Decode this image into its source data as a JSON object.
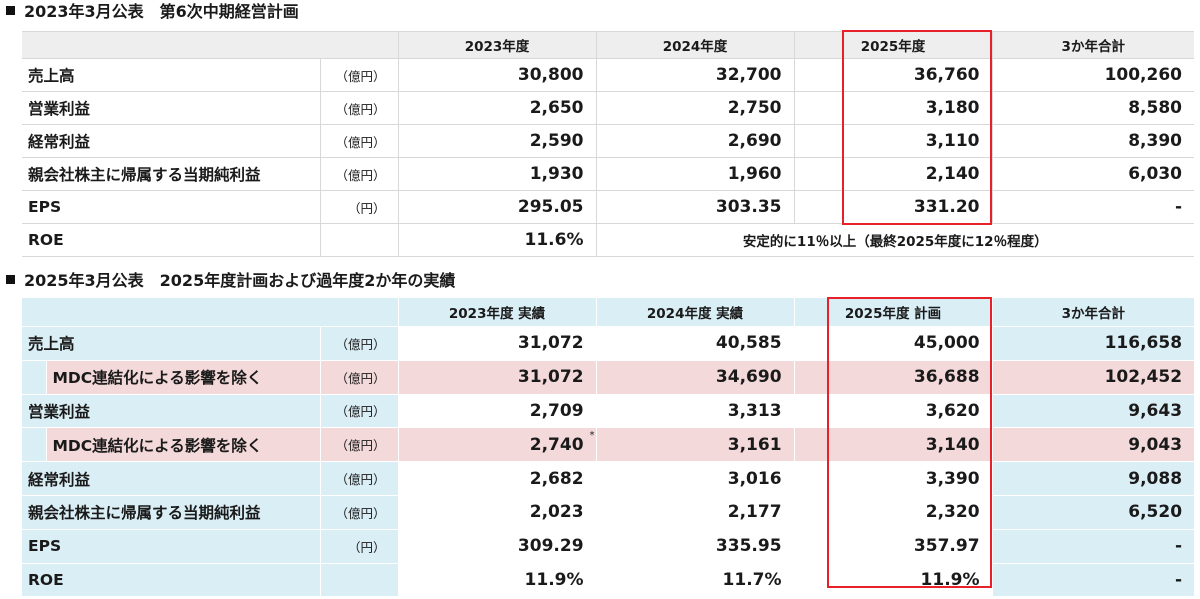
{
  "section1": {
    "title": "2023年3月公表　第6次中期経営計画",
    "headers": [
      "2023年度",
      "2024年度",
      "2025年度",
      "3か年合計"
    ],
    "rows": [
      {
        "label": "売上高",
        "unit": "（億円）",
        "values": [
          "30,800",
          "32,700",
          "36,760",
          "100,260"
        ]
      },
      {
        "label": "営業利益",
        "unit": "（億円）",
        "values": [
          "2,650",
          "2,750",
          "3,180",
          "8,580"
        ]
      },
      {
        "label": "経常利益",
        "unit": "（億円）",
        "values": [
          "2,590",
          "2,690",
          "3,110",
          "8,390"
        ]
      },
      {
        "label": "親会社株主に帰属する当期純利益",
        "unit": "（億円）",
        "values": [
          "1,930",
          "1,960",
          "2,140",
          "6,030"
        ]
      },
      {
        "label": "EPS",
        "unit": "（円）",
        "values": [
          "295.05",
          "303.35",
          "331.20",
          "-"
        ]
      }
    ],
    "roe": {
      "label": "ROE",
      "value": "11.6%",
      "note": "安定的に11％以上（最終2025年度に12％程度）"
    }
  },
  "section2": {
    "title": "2025年3月公表　2025年度計画および過年度2か年の実績",
    "headers": [
      "2023年度 実績",
      "2024年度 実績",
      "2025年度 計画",
      "3か年合計"
    ],
    "rows": [
      {
        "label": "売上高",
        "unit": "（億円）",
        "values": [
          "31,072",
          "40,585",
          "45,000",
          "116,658"
        ]
      },
      {
        "label": "MDC連結化による影響を除く",
        "unit": "（億円）",
        "values": [
          "31,072",
          "34,690",
          "36,688",
          "102,452"
        ]
      },
      {
        "label": "営業利益",
        "unit": "（億円）",
        "values": [
          "2,709",
          "3,313",
          "3,620",
          "9,643"
        ]
      },
      {
        "label": "MDC連結化による影響を除く",
        "unit": "（億円）",
        "values": [
          "2,740",
          "3,161",
          "3,140",
          "9,043"
        ],
        "footnote_mark": "*"
      },
      {
        "label": "経常利益",
        "unit": "（億円）",
        "values": [
          "2,682",
          "3,016",
          "3,390",
          "9,088"
        ]
      },
      {
        "label": "親会社株主に帰属する当期純利益",
        "unit": "（億円）",
        "values": [
          "2,023",
          "2,177",
          "2,320",
          "6,520"
        ]
      },
      {
        "label": "EPS",
        "unit": "（円）",
        "values": [
          "309.29",
          "335.95",
          "357.97",
          "-"
        ]
      },
      {
        "label": "ROE",
        "unit": "",
        "values": [
          "11.9%",
          "11.7%",
          "11.9%",
          "-"
        ]
      }
    ]
  },
  "colors": {
    "highlight_border": "#e8202a",
    "header_blue": "#daeef6",
    "row_pink": "#f4d9da",
    "header_gray": "#eeeeee"
  }
}
